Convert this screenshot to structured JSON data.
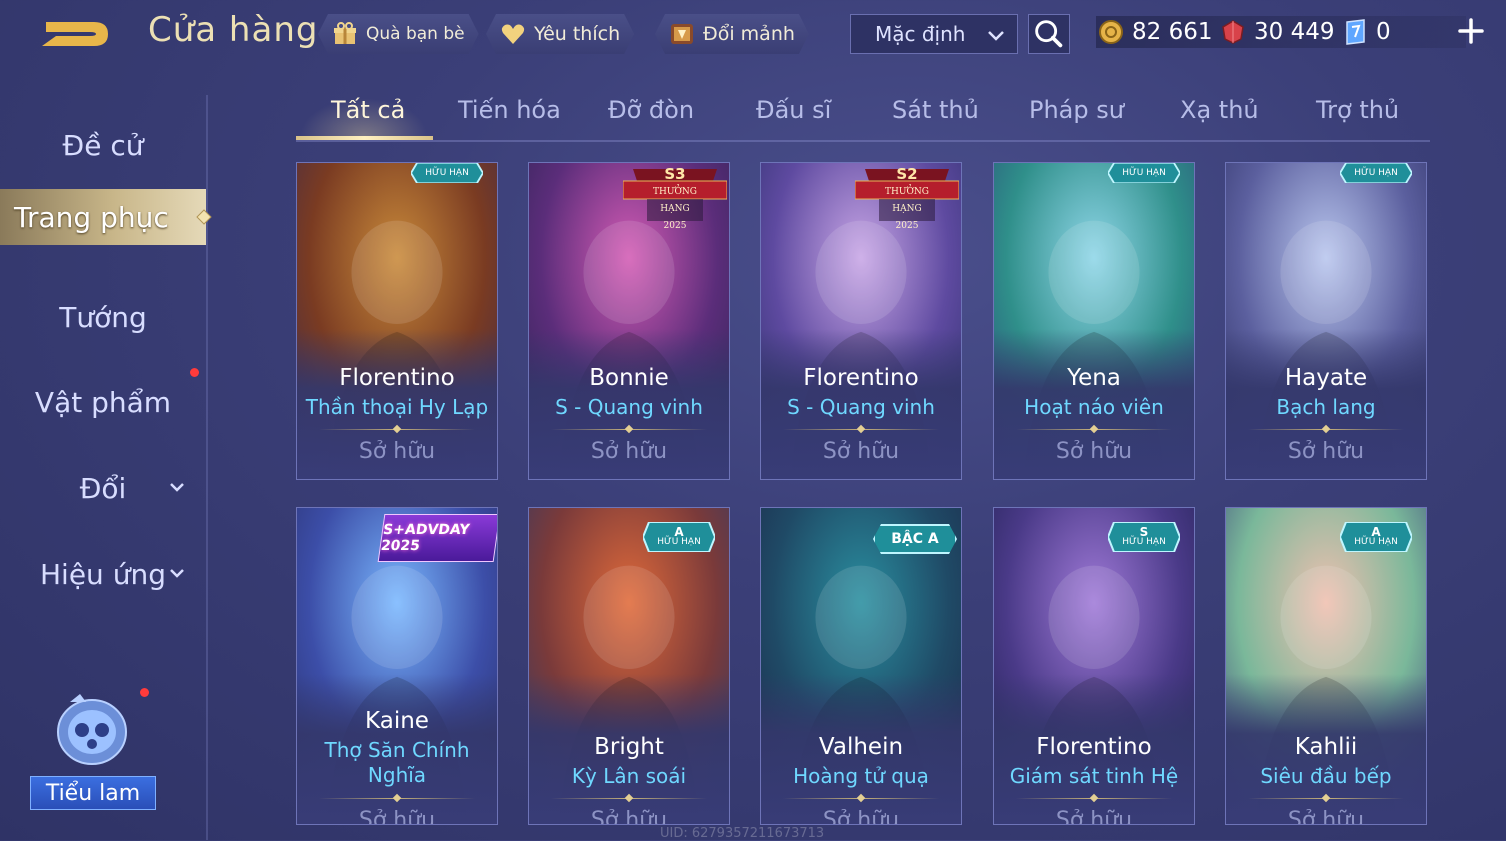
{
  "header": {
    "title": "Cửa hàng",
    "friend_gift": "Quà bạn bè",
    "favorites": "Yêu thích",
    "exchange_shards": "Đổi mảnh",
    "sort_value": "Mặc định",
    "currencies": [
      {
        "icon": "gold-coin-icon",
        "value": "82 661"
      },
      {
        "icon": "red-crystal-icon",
        "value": "30 449"
      },
      {
        "icon": "voucher-icon",
        "value": "0"
      }
    ]
  },
  "sidebar": {
    "items": [
      {
        "label": "Đề cử"
      },
      {
        "label": "Trang phục"
      },
      {
        "label": "Tướng"
      },
      {
        "label": "Vật phẩm"
      },
      {
        "label": "Đổi"
      },
      {
        "label": "Hiệu ứng"
      }
    ],
    "mascot_label": "Tiểu lam"
  },
  "tabs": [
    "Tất cả",
    "Tiến hóa",
    "Đỡ đòn",
    "Đấu sĩ",
    "Sát thủ",
    "Pháp sư",
    "Xạ thủ",
    "Trợ thủ"
  ],
  "cards": [
    {
      "hero": "Florentino",
      "skin": "Thần thoại Hy Lạp",
      "status": "Sở hữu",
      "badge": "HỮU HẠN",
      "badge_type": "tier",
      "colors": [
        "#c98a3a",
        "#7a3b22",
        "#3a2a50"
      ]
    },
    {
      "hero": "Bonnie",
      "skin": "S - Quang vinh",
      "status": "Sở hữu",
      "badge": "THƯỞNG HẠNG 2025",
      "badge_season": "S3",
      "badge_type": "rank",
      "colors": [
        "#d35bb4",
        "#5b2d7a",
        "#2c2452"
      ]
    },
    {
      "hero": "Florentino",
      "skin": "S - Quang vinh",
      "status": "Sở hữu",
      "badge": "THƯỞNG HẠNG 2025",
      "badge_season": "S2",
      "badge_type": "rank",
      "colors": [
        "#c8a6e6",
        "#5e4aa0",
        "#2c2f6a"
      ]
    },
    {
      "hero": "Yena",
      "skin": "Hoạt náo viên",
      "status": "Sở hữu",
      "badge": "HỮU HẠN",
      "badge_type": "tier",
      "colors": [
        "#8fd6e8",
        "#2f8f8a",
        "#2b4a78"
      ]
    },
    {
      "hero": "Hayate",
      "skin": "Bạch lang",
      "status": "Sở hữu",
      "badge": "HỮU HẠN",
      "badge_type": "tier",
      "colors": [
        "#b9c6ee",
        "#5b5f9e",
        "#2c2f63"
      ]
    },
    {
      "hero": "Kaine",
      "skin_line1": "Thợ Săn Chính",
      "skin_line2": "Nghĩa",
      "status": "Sở hữu",
      "badge": "S+ADVDAY 2025",
      "badge_type": "event",
      "colors": [
        "#7ab8ff",
        "#3c4ea8",
        "#2a2f6a"
      ]
    },
    {
      "hero": "Bright",
      "skin": "Kỳ Lân soái",
      "status": "Sở hữu",
      "badge_tier": "A",
      "badge": "HỮU HẠN",
      "badge_type": "tier",
      "colors": [
        "#e06a3a",
        "#7a3a3a",
        "#2c3a6a"
      ]
    },
    {
      "hero": "Valhein",
      "skin": "Hoàng tử quạ",
      "status": "Sở hữu",
      "badge": "BẬC A",
      "badge_type": "grade",
      "colors": [
        "#2a8fa0",
        "#1f4a66",
        "#1d2748"
      ]
    },
    {
      "hero": "Florentino",
      "skin": "Giám sát tinh Hệ",
      "status": "Sở hữu",
      "badge_tier": "S",
      "badge": "HỮU HẠN",
      "badge_type": "tier",
      "colors": [
        "#a07ad8",
        "#4a3a88",
        "#1f2050"
      ]
    },
    {
      "hero": "Kahlii",
      "skin": "Siêu đầu bếp",
      "status": "Sở hữu",
      "badge_tier": "A",
      "badge": "HỮU HẠN",
      "badge_type": "tier",
      "colors": [
        "#f0c0b0",
        "#7ab89a",
        "#3a3f7a"
      ]
    }
  ],
  "uid": "UID: 6279357211673713"
}
